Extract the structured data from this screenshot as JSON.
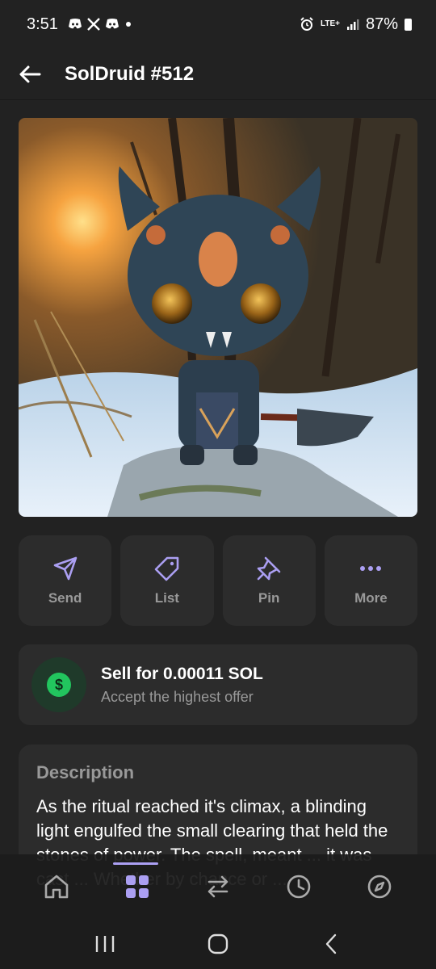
{
  "status_bar": {
    "time": "3:51",
    "left_icons": [
      "discord-icon",
      "x-icon",
      "discord-icon",
      "dot-icon"
    ],
    "network": "LTE+",
    "battery": "87%"
  },
  "header": {
    "title": "SolDruid #512"
  },
  "nft": {
    "image_description": "figurine-of-horned-druid-with-axe"
  },
  "actions": [
    {
      "label": "Send",
      "icon": "send-icon"
    },
    {
      "label": "List",
      "icon": "tag-icon"
    },
    {
      "label": "Pin",
      "icon": "pin-icon"
    },
    {
      "label": "More",
      "icon": "more-icon"
    }
  ],
  "sell": {
    "title": "Sell for 0.00011 SOL",
    "subtitle": "Accept the highest offer",
    "icon_symbol": "$"
  },
  "description": {
    "heading": "Description",
    "body": "As the ritual reached it's climax, a blinding light engulfed the small clearing that held the stones of power. The spell, meant ... it was cast ... Whether by chance or ..."
  },
  "bottom_nav": [
    {
      "name": "home",
      "icon": "home-icon"
    },
    {
      "name": "collectibles",
      "icon": "grid-icon",
      "active": true
    },
    {
      "name": "swap",
      "icon": "swap-icon"
    },
    {
      "name": "activity",
      "icon": "clock-icon"
    },
    {
      "name": "explore",
      "icon": "compass-icon"
    }
  ],
  "colors": {
    "accent": "#ab9ff2",
    "background": "#222222",
    "card": "#2c2c2c",
    "success": "#22c55e"
  }
}
